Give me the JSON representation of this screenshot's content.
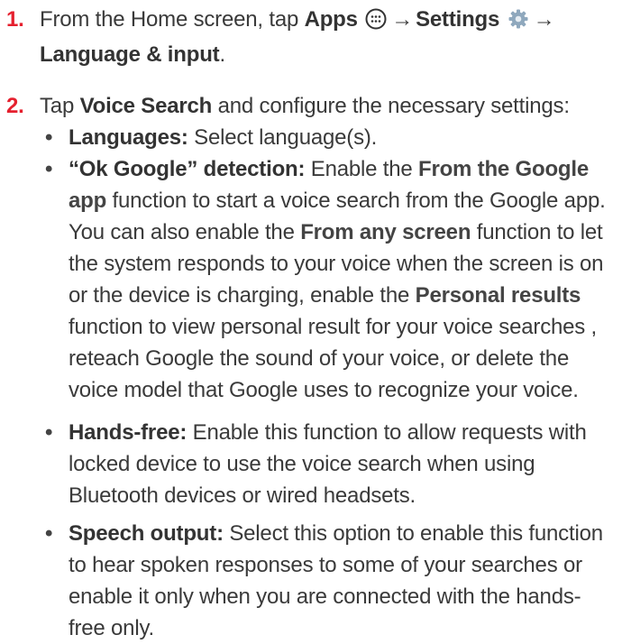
{
  "steps": [
    {
      "number": "1.",
      "pre": "From the Home screen, tap ",
      "apps": "Apps",
      "arrow1": "→",
      "settings": "Settings",
      "arrow2": "→",
      "language_input": "Language & input",
      "end": ".",
      "icons": [
        "apps-grid-icon",
        "settings-gear-icon"
      ]
    },
    {
      "number": "2.",
      "pre": "Tap ",
      "voice_search": "Voice Search",
      "post": " and configure the necessary settings:"
    }
  ],
  "options": [
    {
      "bullet": "•",
      "title": "Languages:",
      "parts": [
        {
          "t": " Select language(s).",
          "bold": false
        }
      ]
    },
    {
      "bullet": "•",
      "title": "“Ok Google” detection:",
      "parts": [
        {
          "t": " Enable the ",
          "bold": false
        },
        {
          "t": "From the Google app",
          "bold": true
        },
        {
          "t": " function to start a voice search from the Google app. You can also enable the ",
          "bold": false
        },
        {
          "t": "From any screen",
          "bold": true
        },
        {
          "t": " function to let the system responds to your voice when the screen is on or the device is charging, enable the ",
          "bold": false
        },
        {
          "t": "Personal results",
          "bold": true
        },
        {
          "t": " function to view personal result for your voice searches , reteach Google the sound of your voice, or delete the voice model that Google uses to recognize your voice.",
          "bold": false
        }
      ]
    },
    {
      "bullet": "•",
      "title": "Hands-free:",
      "parts": [
        {
          "t": " Enable this function to allow requests with locked device to use the voice search when using Bluetooth devices or wired headsets.",
          "bold": false
        }
      ]
    },
    {
      "bullet": "•",
      "title": "Speech output:",
      "parts": [
        {
          "t": " Select this option to enable this function to hear spoken responses to some of your searches or enable it only when you are connected with the hands-free only.",
          "bold": false
        }
      ]
    }
  ],
  "colors": {
    "accent": "#e5202e",
    "text": "#3a3a3a"
  }
}
